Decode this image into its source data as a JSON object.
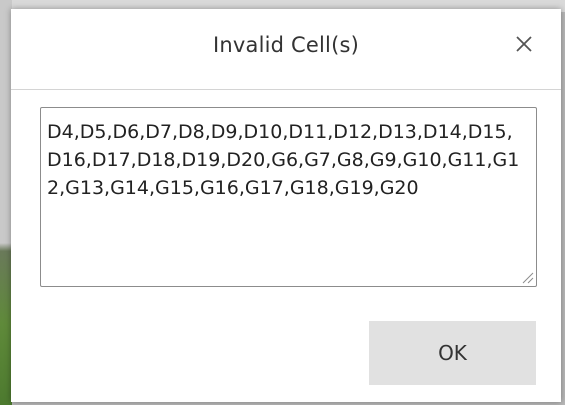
{
  "dialog": {
    "title": "Invalid Cell(s)",
    "close_icon": "close-icon",
    "cells_text": "D4,D5,D6,D7,D8,D9,D10,D11,D12,D13,D14,D15,D16,D17,D18,D19,D20,G6,G7,G8,G9,G10,G11,G12,G13,G14,G15,G16,G17,G18,G19,G20",
    "ok_label": "OK"
  },
  "colors": {
    "button_background": "#e1e1e1",
    "title_text": "#333333",
    "textarea_border": "#8c8c8c"
  }
}
